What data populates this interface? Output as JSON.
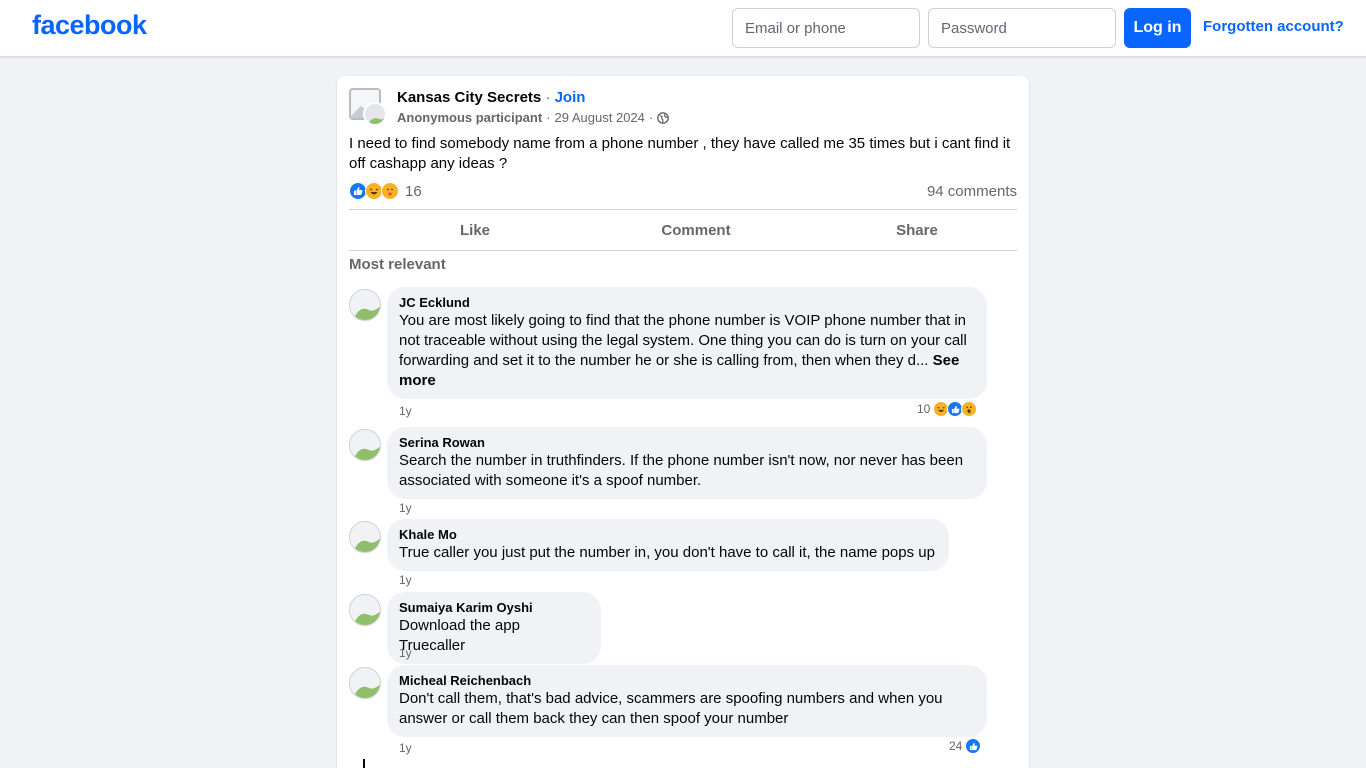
{
  "header": {
    "logo": "facebook",
    "email_placeholder": "Email or phone",
    "password_placeholder": "Password",
    "login_label": "Log in",
    "forgot_label": "Forgotten account?"
  },
  "post": {
    "group_name": "Kansas City Secrets",
    "separator": " · ",
    "join_label": "Join",
    "author": "Anonymous participant",
    "meta_sep": "·",
    "date": "29 August 2024",
    "meta_sep2": "·",
    "text": "I need to find somebody name from a phone number , they have called me 35 times but i cant find it off cashapp any ideas ?",
    "reaction_count": "16",
    "comments_count": "94 comments",
    "actions": {
      "like": "Like",
      "comment": "Comment",
      "share": "Share"
    },
    "sort_label": "Most relevant"
  },
  "comments": [
    {
      "author": "JC Ecklund",
      "text": "You are most likely going to find that the phone number is VOIP phone number that in not traceable without using the legal system. One thing you can do is turn on your call forwarding and set it to the number he or she is calling from, then when they d...",
      "see_more": " See more",
      "time": "1y",
      "reactions": "10"
    },
    {
      "author": "Serina Rowan",
      "text": "Search the number in truthfinders. If the phone number isn't now, nor never has been associated with someone it's a spoof number.",
      "time": "1y"
    },
    {
      "author": "Khale Mo",
      "text": "True caller you just put the number in, you don't have to call it, the name pops up",
      "time": "1y"
    },
    {
      "author": "Sumaiya Karim Oyshi",
      "text": "Download the app Truecaller",
      "time": "1y"
    },
    {
      "author": "Micheal Reichenbach",
      "text": "Don't call them, that's bad advice, scammers are spoofing numbers and when you answer or call them back they can then spoof your number",
      "time": "1y",
      "reactions": "24"
    }
  ],
  "colors": {
    "brand": "#0866ff",
    "bubble": "#f0f2f5",
    "muted": "#65676b",
    "like": "#1877f2"
  },
  "icons": {
    "globe": "globe-icon",
    "like": "like-reaction-icon",
    "haha": "haha-reaction-icon",
    "care": "care-reaction-icon",
    "wow": "wow-reaction-icon"
  }
}
